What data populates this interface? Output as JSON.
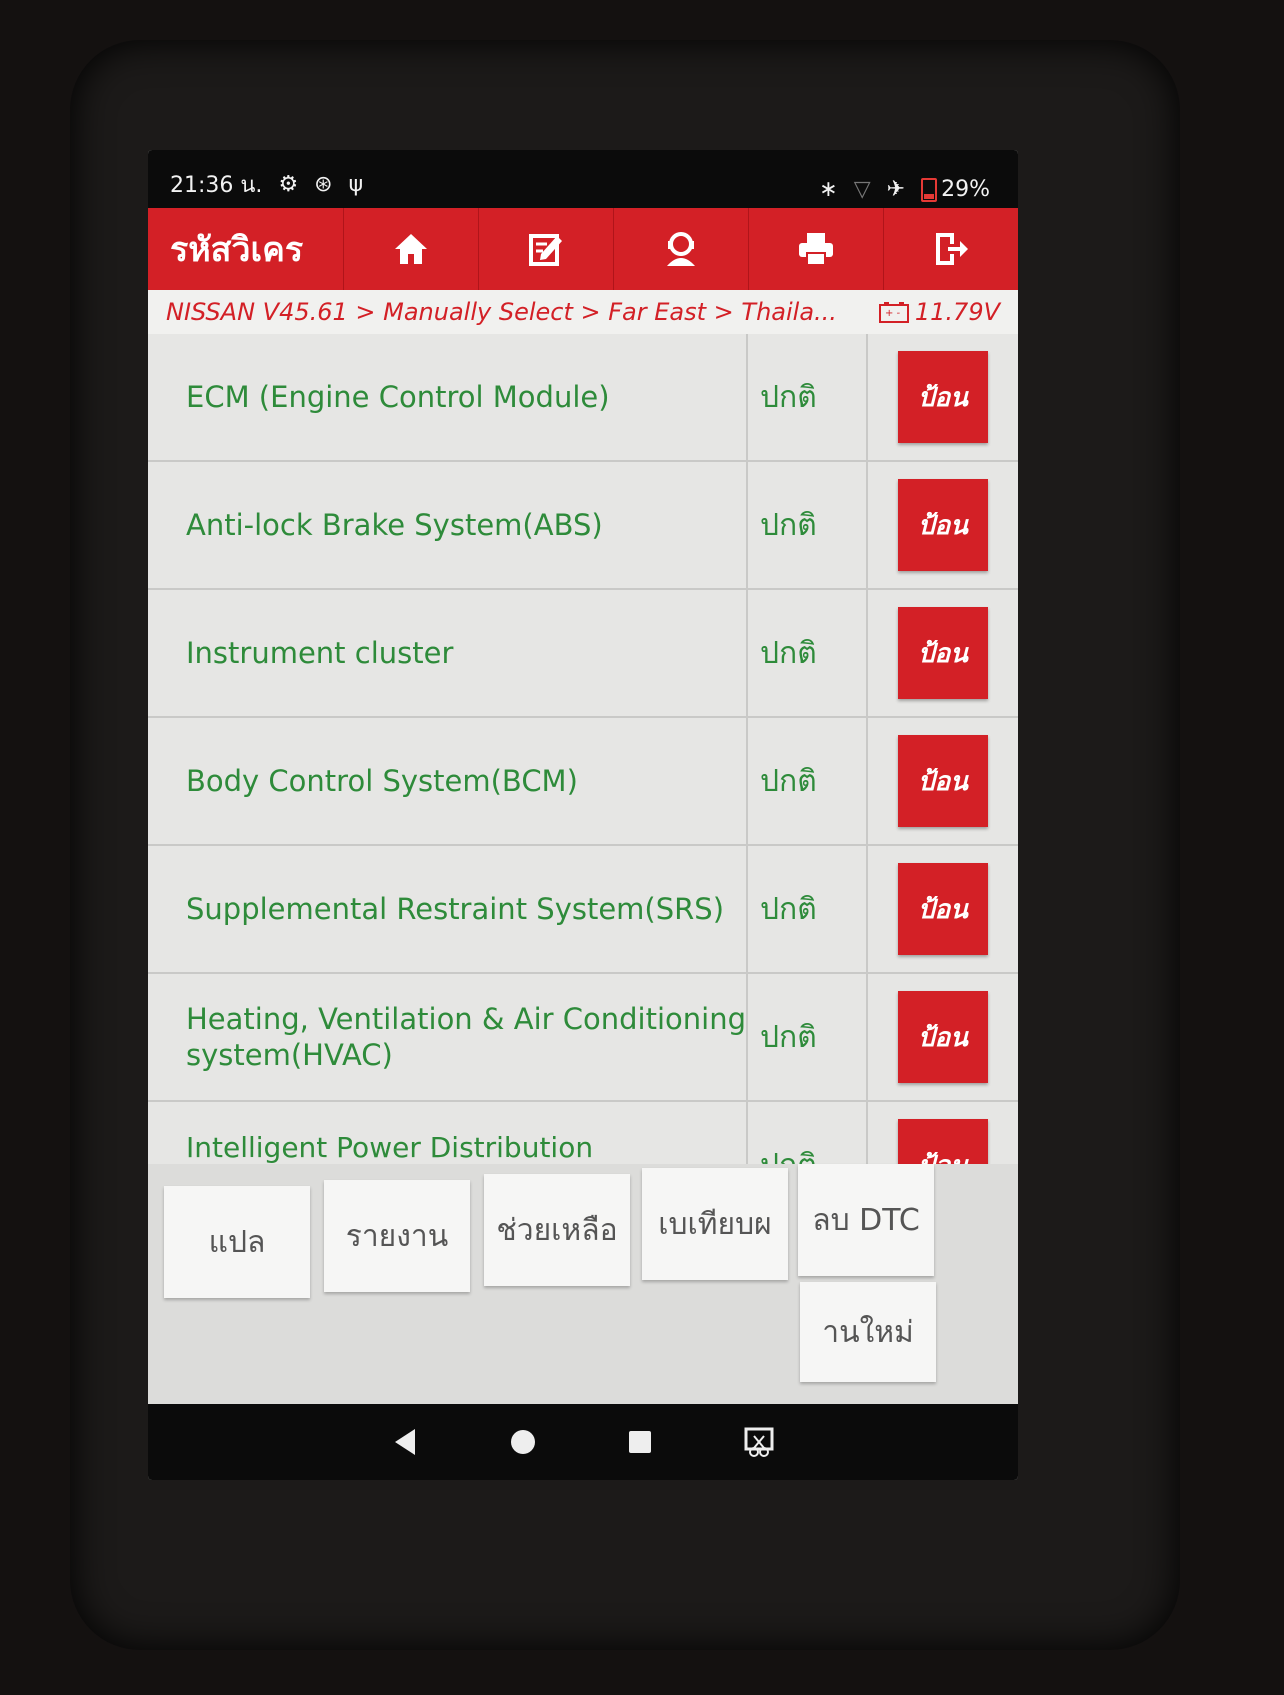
{
  "status_bar": {
    "time": "21:36 น.",
    "battery": "29%"
  },
  "header": {
    "title": "รหัสวิเคร",
    "nav_icons": [
      "home-icon",
      "edit-icon",
      "support-icon",
      "print-icon",
      "exit-icon"
    ]
  },
  "breadcrumb": {
    "path": "NISSAN V45.61 > Manually Select > Far East > Thaila...",
    "voltage": "11.79V"
  },
  "systems": [
    {
      "name": "ECM (Engine Control Module)",
      "status": "ปกติ",
      "action": "ป้อน"
    },
    {
      "name": "Anti-lock Brake System(ABS)",
      "status": "ปกติ",
      "action": "ป้อน"
    },
    {
      "name": "Instrument cluster",
      "status": "ปกติ",
      "action": "ป้อน"
    },
    {
      "name": "Body Control System(BCM)",
      "status": "ปกติ",
      "action": "ป้อน"
    },
    {
      "name": "Supplemental Restraint System(SRS)",
      "status": "ปกติ",
      "action": "ป้อน"
    },
    {
      "name": "Heating, Ventilation & Air Conditioning system(HVAC)",
      "status": "ปกติ",
      "action": "ป้อน"
    },
    {
      "name": "Intelligent Power Distribution Unit(IPDU)",
      "status": "ปกติ",
      "action": "ป้อน"
    }
  ],
  "toolbar": {
    "translate": "แปล",
    "report": "รายงาน",
    "help": "ช่วยเหลือ",
    "compare": "เบเทียบผ",
    "clear_dtc": "ลบ DTC",
    "rescan": "านใหม่"
  },
  "colors": {
    "accent": "#d32026",
    "text_green": "#2e8b3a"
  }
}
